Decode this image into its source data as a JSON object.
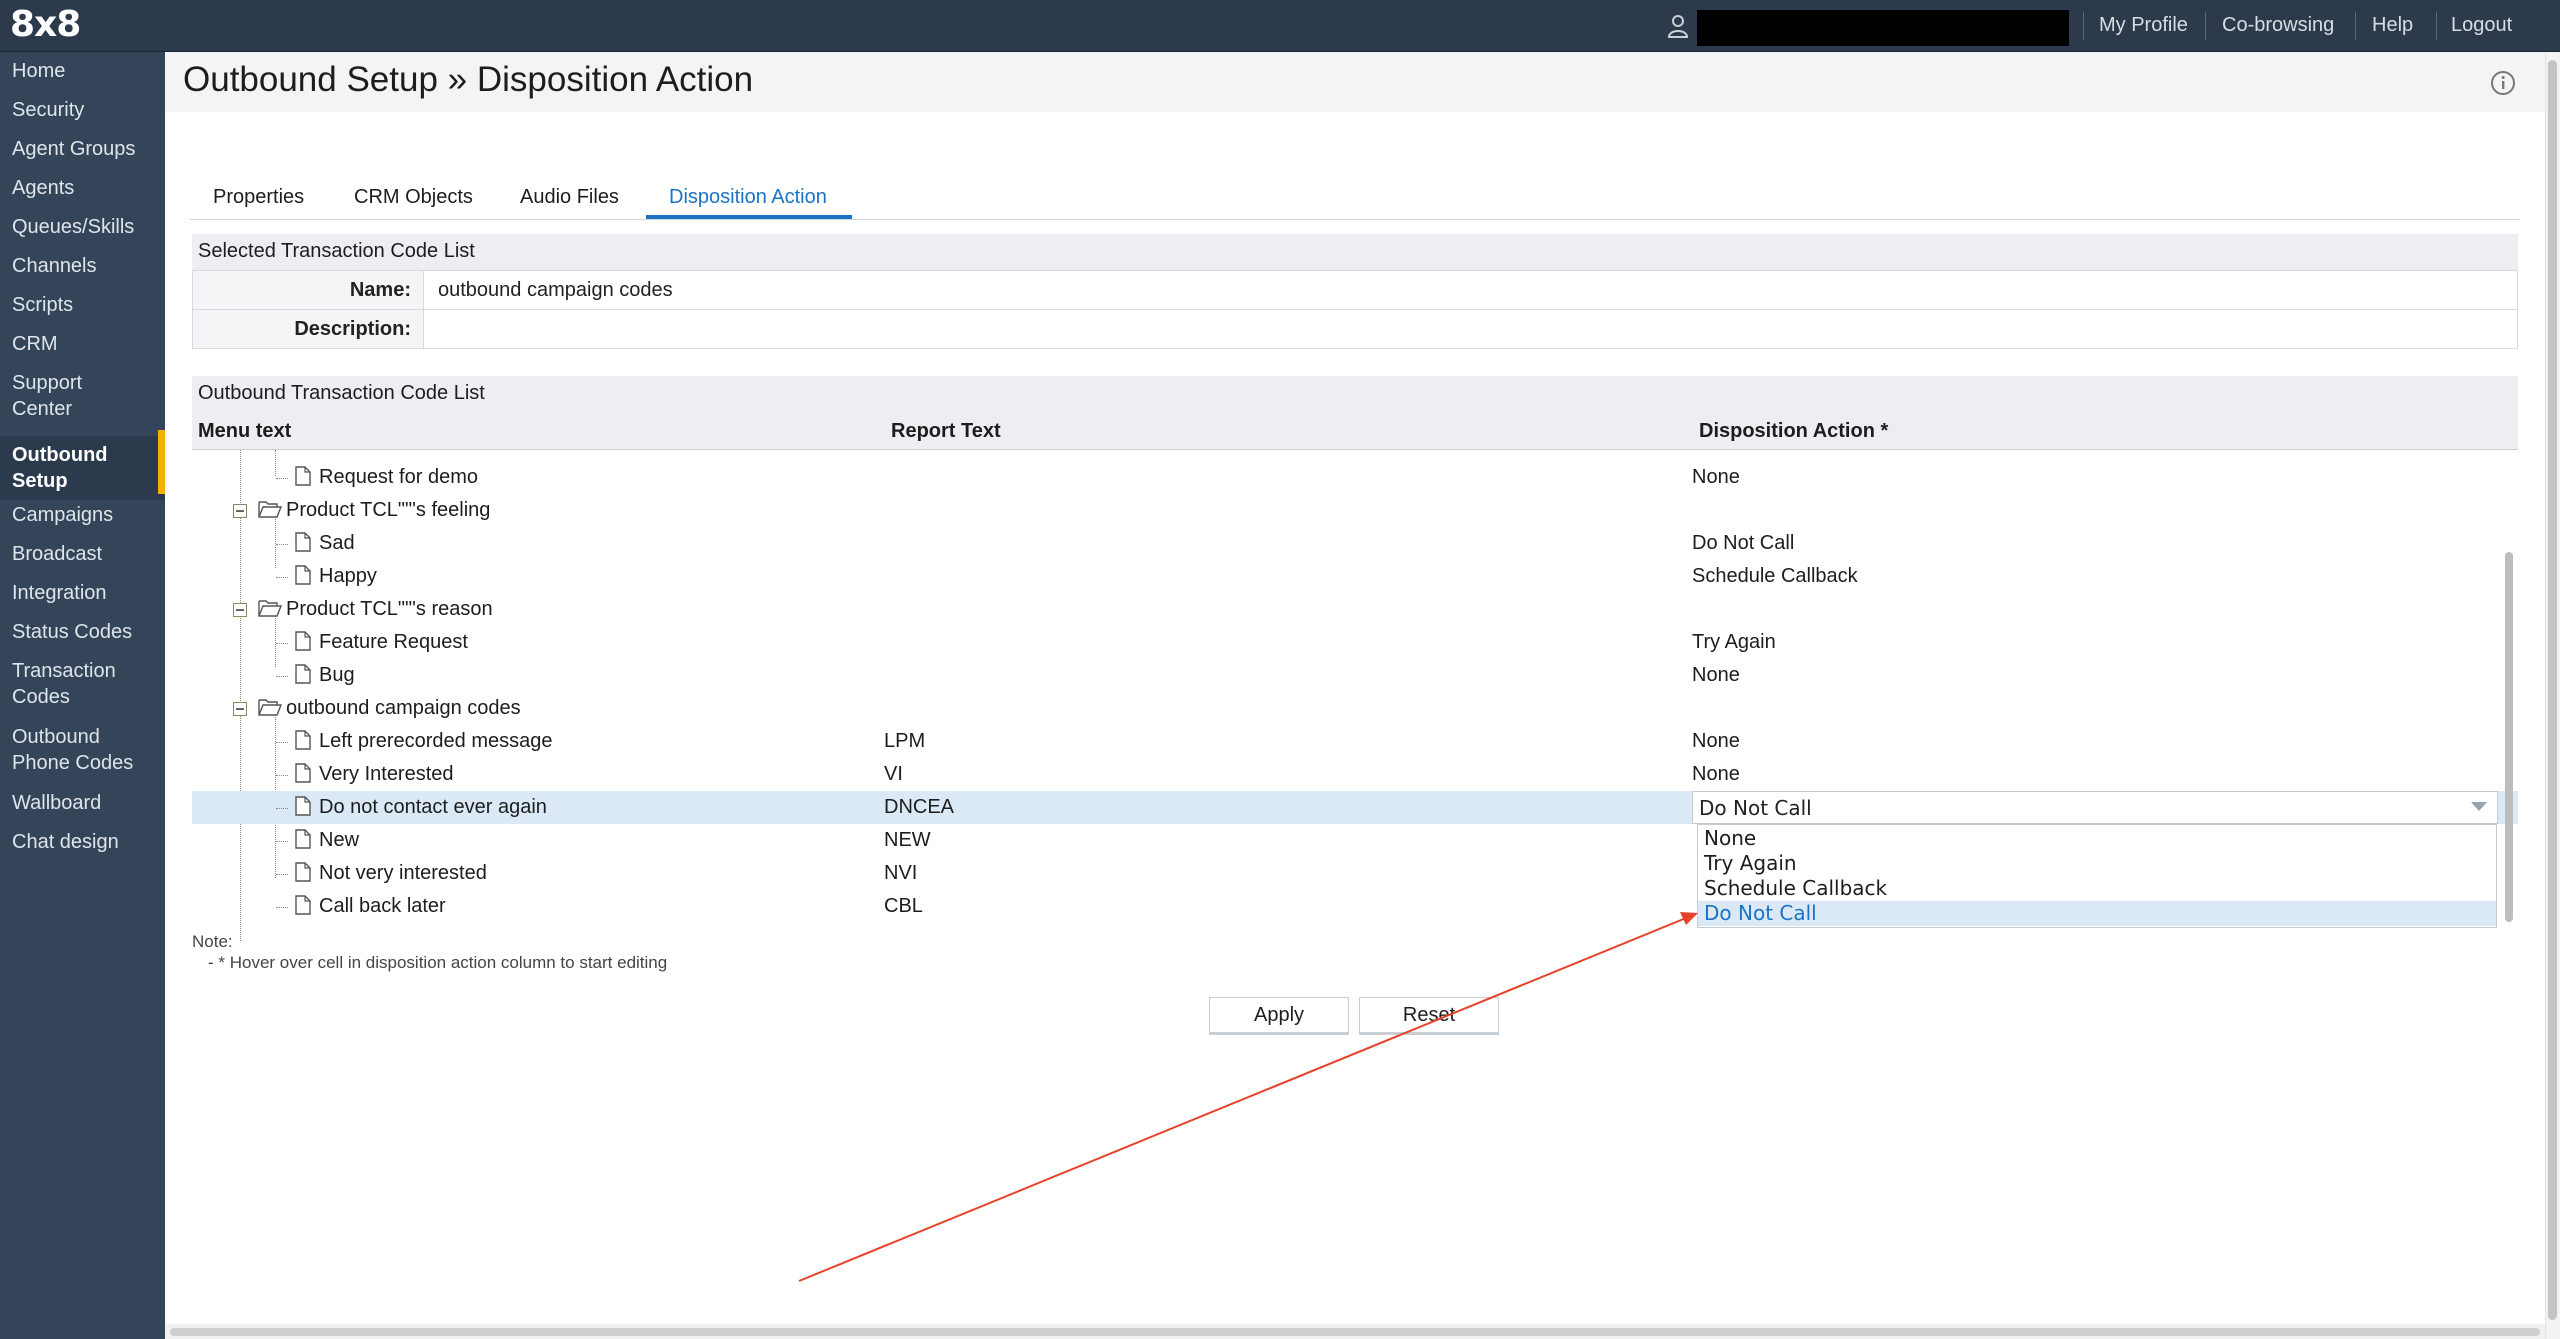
{
  "brand": {
    "logo": "8x8"
  },
  "topbar": {
    "links": [
      "My Profile",
      "Co-browsing",
      "Help",
      "Logout"
    ]
  },
  "sidebar": {
    "items": [
      "Home",
      "Security",
      "Agent Groups",
      "Agents",
      "Queues/Skills",
      "Channels",
      "Scripts",
      "CRM",
      "Support\nCenter",
      "Outbound\nSetup",
      "Campaigns",
      "Broadcast",
      "Integration",
      "Status Codes",
      "Transaction\nCodes",
      "Outbound\nPhone Codes",
      "Wallboard",
      "Chat design"
    ],
    "active": "Outbound\nSetup"
  },
  "page": {
    "title": "Outbound Setup » Disposition Action"
  },
  "tabs": {
    "items": [
      "Properties",
      "CRM Objects",
      "Audio Files",
      "Disposition Action"
    ],
    "active": "Disposition Action"
  },
  "selected_list": {
    "heading": "Selected Transaction Code List",
    "name_label": "Name:",
    "name_value": "outbound campaign codes",
    "description_label": "Description:",
    "description_value": ""
  },
  "grid": {
    "heading": "Outbound Transaction Code List",
    "columns": [
      "Menu text",
      "Report Text",
      "Disposition Action *"
    ],
    "rows": [
      {
        "type": "item",
        "menu": "Request for demo",
        "report": "",
        "action": "None"
      },
      {
        "type": "folder",
        "menu": "Product TCL\"\"'s feeling",
        "report": "",
        "action": ""
      },
      {
        "type": "item",
        "menu": "Sad",
        "report": "",
        "action": "Do Not Call"
      },
      {
        "type": "item",
        "menu": "Happy",
        "report": "",
        "action": "Schedule Callback"
      },
      {
        "type": "folder",
        "menu": "Product TCL\"\"'s reason",
        "report": "",
        "action": ""
      },
      {
        "type": "item",
        "menu": "Feature Request",
        "report": "",
        "action": "Try Again"
      },
      {
        "type": "item",
        "menu": "Bug",
        "report": "",
        "action": "None"
      },
      {
        "type": "folder",
        "menu": "outbound campaign codes",
        "report": "",
        "action": ""
      },
      {
        "type": "item",
        "menu": "Left prerecorded message",
        "report": "LPM",
        "action": "None"
      },
      {
        "type": "item",
        "menu": "Very Interested",
        "report": "VI",
        "action": "None"
      },
      {
        "type": "item",
        "menu": "Do not contact ever again",
        "report": "DNCEA",
        "action": ""
      },
      {
        "type": "item",
        "menu": "New",
        "report": "NEW",
        "action": ""
      },
      {
        "type": "item",
        "menu": "Not very interested",
        "report": "NVI",
        "action": ""
      },
      {
        "type": "item",
        "menu": "Call back later",
        "report": "CBL",
        "action": ""
      }
    ]
  },
  "dropdown": {
    "value": "Do Not Call",
    "options": [
      "None",
      "Try Again",
      "Schedule Callback",
      "Do Not Call"
    ],
    "selected": "Do Not Call"
  },
  "note": {
    "label": "Note:",
    "text": "- * Hover over cell in disposition action column to start editing"
  },
  "buttons": {
    "apply": "Apply",
    "reset": "Reset"
  },
  "colors": {
    "topbar": "#2c3a4c",
    "sidebar": "#34455a",
    "accent": "#1b73c4",
    "active_marker": "#f0b400",
    "annotation": "#e8432a"
  }
}
